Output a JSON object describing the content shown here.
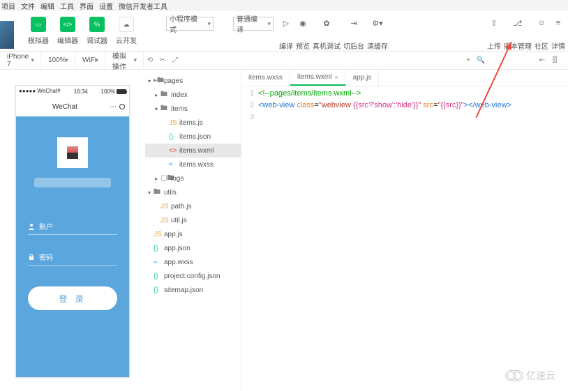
{
  "menubar": [
    "项目",
    "文件",
    "编辑",
    "工具",
    "界面",
    "设置",
    "微信开发者工具"
  ],
  "toolbar": {
    "left": [
      {
        "label": "模拟器",
        "style": "green",
        "glyph": "▭"
      },
      {
        "label": "编辑器",
        "style": "green",
        "glyph": "</>"
      },
      {
        "label": "调试器",
        "style": "green",
        "glyph": "%"
      },
      {
        "label": "云开发",
        "style": "plain",
        "glyph": "☁"
      }
    ],
    "mode_dropdown": "小程序模式",
    "compile_dropdown": "普通编译",
    "mid": [
      {
        "label": "编译",
        "glyph": "▷"
      },
      {
        "label": "预览",
        "glyph": "◉"
      },
      {
        "label": "真机调试",
        "glyph": "✿"
      },
      {
        "label": "切后台",
        "glyph": "⇥"
      },
      {
        "label": "清缓存",
        "glyph": "⚙▾"
      }
    ],
    "right": [
      {
        "label": "上传",
        "glyph": "⇧"
      },
      {
        "label": "版本管理",
        "glyph": "⎇"
      },
      {
        "label": "社区",
        "glyph": "☺"
      },
      {
        "label": "详情",
        "glyph": "≡"
      }
    ]
  },
  "subbar": {
    "device": "iPhone 7",
    "zoom": "100%",
    "network": "WiFi",
    "mock": "模拟操作"
  },
  "tree": [
    {
      "indent": 0,
      "tw": "▾",
      "icon": "fold",
      "glyph": "▸🖿",
      "name": "pages"
    },
    {
      "indent": 1,
      "tw": "▸",
      "icon": "fold",
      "glyph": "🖿",
      "name": "index"
    },
    {
      "indent": 1,
      "tw": "▾",
      "icon": "fold",
      "glyph": "🖿",
      "name": "items"
    },
    {
      "indent": 2,
      "tw": "",
      "icon": "js",
      "glyph": "JS",
      "name": "items.js"
    },
    {
      "indent": 2,
      "tw": "",
      "icon": "json",
      "glyph": "{}",
      "name": "items.json"
    },
    {
      "indent": 2,
      "tw": "",
      "icon": "wxml",
      "glyph": "<>",
      "name": "items.wxml",
      "sel": true
    },
    {
      "indent": 2,
      "tw": "",
      "icon": "wxss",
      "glyph": "≈",
      "name": "items.wxss"
    },
    {
      "indent": 1,
      "tw": "▸",
      "icon": "fold",
      "glyph": "▢🖿",
      "name": "logs"
    },
    {
      "indent": 0,
      "tw": "▾",
      "icon": "fold",
      "glyph": "🖿",
      "name": "utils"
    },
    {
      "indent": 1,
      "tw": "",
      "icon": "js",
      "glyph": "JS",
      "name": "path.js"
    },
    {
      "indent": 1,
      "tw": "",
      "icon": "js",
      "glyph": "JS",
      "name": "util.js"
    },
    {
      "indent": 0,
      "tw": "",
      "icon": "js",
      "glyph": "JS",
      "name": "app.js"
    },
    {
      "indent": 0,
      "tw": "",
      "icon": "json",
      "glyph": "{}",
      "name": "app.json"
    },
    {
      "indent": 0,
      "tw": "",
      "icon": "wxss",
      "glyph": "≈",
      "name": "app.wxss"
    },
    {
      "indent": 0,
      "tw": "",
      "icon": "json",
      "glyph": "{}",
      "name": "project.config.json"
    },
    {
      "indent": 0,
      "tw": "",
      "icon": "json",
      "glyph": "{}",
      "name": "sitemap.json"
    }
  ],
  "tabs": [
    {
      "label": "items.wxss",
      "active": false
    },
    {
      "label": "items.wxml",
      "active": true
    },
    {
      "label": "app.js",
      "active": false
    }
  ],
  "code": {
    "lines": [
      "1",
      "2",
      "3"
    ],
    "l1_comment": "<!--pages/items/items.wxml-->",
    "l2_tag_open": "<",
    "l2_tag": "web-view",
    "l2_sp": " ",
    "l2_attr1": "class",
    "l2_eq": "=",
    "l2_q": "\"",
    "l2_val1": "webview ",
    "l2_tmpl1": "{{src?'show':'hide'}}",
    "l2_attr2": "src",
    "l2_tmpl2": "{{src}}",
    "l2_close": "></",
    "l2_tag2": "web-view",
    "l2_end": ">"
  },
  "sim": {
    "carrier": "●●●●● WeChat🕈",
    "time": "16:34",
    "batt": "100%",
    "title": "WeChat",
    "field_user": "账户",
    "field_pass": "密码",
    "login": "登 录"
  },
  "watermark": "亿速云"
}
